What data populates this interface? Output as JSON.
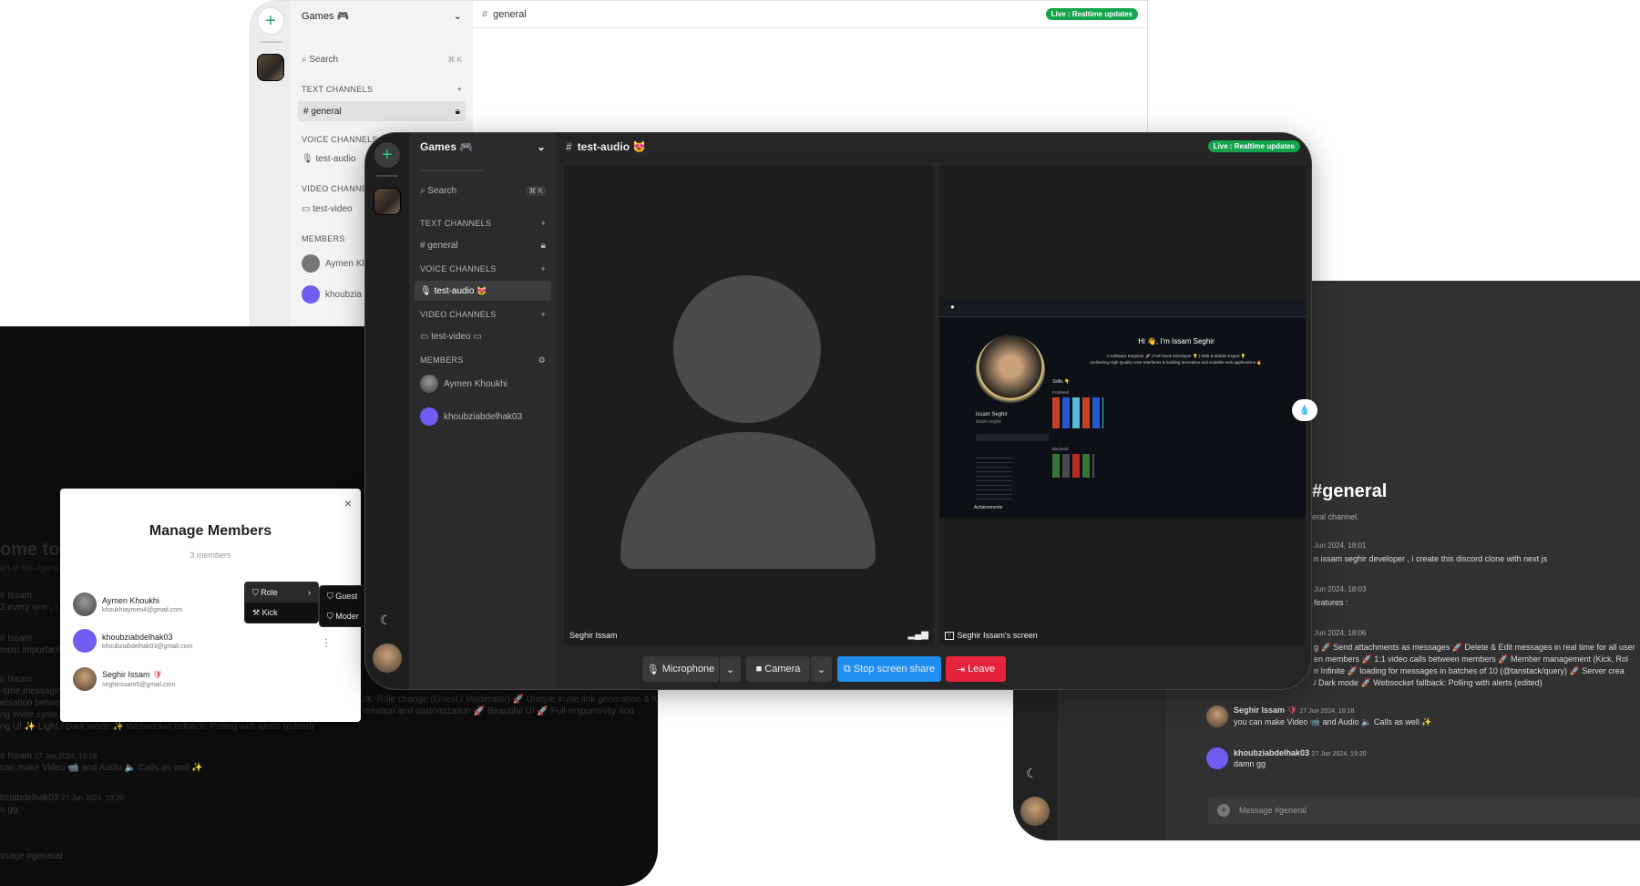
{
  "server": {
    "name": "Games",
    "emoji": "🎮"
  },
  "search": {
    "label": "Search",
    "shortcut": "⌘ K"
  },
  "sections": {
    "text": "TEXT CHANNELS",
    "voice": "VOICE CHANNELS",
    "video": "VIDEO CHANNELS",
    "members": "MEMBERS"
  },
  "channels": {
    "general": "general",
    "audio": "test-audio",
    "video": "test-video"
  },
  "live_badge": "Live : Realtime updates",
  "light_window": {
    "topbar_channel": "general",
    "voice_truncated": "VOICE CHANNELS",
    "video_truncated": "VIDEO CHANNE",
    "video_item": "test-video",
    "member1": "Aymen Kl",
    "member2": "khoubzia"
  },
  "main_window": {
    "topbar_channel": "test-audio",
    "members": [
      "Aymen Khoukhi",
      "khoubziabdelhak03"
    ],
    "tile_left_label": "Seghir Issam",
    "tile_right_label": "Seghir Issam's screen",
    "controls": {
      "mic": "Microphone",
      "camera": "Camera",
      "share": "Stop screen share",
      "leave": "Leave"
    },
    "shared_screen": {
      "greeting": "Hi 👋, I'm Issam Seghir",
      "tagline": "A Software Engineer 🚀 | Full Stack Developer 💡 | Web & Mobile Expert 💡",
      "tagline2": "Delivering High Quality User Interfaces & building innovative and scalable web applications 🔥",
      "skills": "Skills 👇",
      "frontend": "Frontend",
      "backend": "Backend",
      "profile_name": "issam Seghir",
      "profile_user": "issam seghir",
      "achievements": "Achievements"
    }
  },
  "modal": {
    "title": "Manage Members",
    "count": "3 members",
    "close": "×",
    "members": [
      {
        "name": "Aymen Khoukhi",
        "email": "khoukhiaymen4@gmail.com"
      },
      {
        "name": "khoubziabdelhak03",
        "email": "khoubziabdelhak03@gmail.com"
      },
      {
        "name": "Seghir Issam",
        "email": "seghirissam5@gmail.com"
      }
    ],
    "menu": {
      "role": "Role",
      "kick": "Kick",
      "guest": "Guest",
      "moderator": "Moder"
    }
  },
  "left_bg": {
    "welcome": "ome to",
    "sub": "art of this #gene",
    "names": [
      "ir Issam",
      "ir Issam",
      "ir Issam",
      "ir Issam",
      "bziabdelhak03"
    ],
    "lines": [
      "2 every one , i",
      "most important",
      "-time messaging",
      "ersation betwee",
      "ng invite syste",
      "ng UI  ✨ Light / Dark mode ✨ Websocket fallback: Polling with alerts (edited)",
      "can make Video 📹 and Audio 🔈 Calls as well ✨",
      "n gg"
    ],
    "mid": [
      "ck, Role change (Guest / Moderator) 🚀 Unique invite link generation & full",
      "creation and customization 🚀 Beautiful UI 🚀 Full responsivity and"
    ],
    "ts1": "27 Jun 2024, 18:18",
    "ts2": "27 Jun 2024, 19:20",
    "input": "ssage #general"
  },
  "right_window": {
    "title": "#general",
    "subtitle": "eral channel.",
    "messages": [
      {
        "ts": "Jun 2024, 18:01",
        "text": "n issam seghir developer , i create this discord clone with next js"
      },
      {
        "ts": "Jun 2024, 18:03",
        "text": "features :"
      },
      {
        "ts": "Jun 2024, 18:06",
        "text": "g 🚀 Send attachments as messages 🚀 Delete & Edit messages in real time for all user"
      },
      {
        "ts": "",
        "text": "en members 🚀 1:1 video calls between members 🚀 Member management (Kick, Rol"
      },
      {
        "ts": "",
        "text": "n Infinite 🚀 loading for messages in batches of 10 (@tanstack/query) 🚀 Server crea"
      },
      {
        "ts": "",
        "text": "/ Dark mode 🚀 Websocket fallback: Polling with alerts (edited)"
      }
    ],
    "m1_name": "Seghir Issam",
    "m1_ts": "27 Jun 2024, 18:18",
    "m1_text": "you can make Video 📹 and Audio 🔈 Calls as well ✨",
    "m2_name": "khoubziabdelhak03",
    "m2_ts": "27 Jun 2024, 19:20",
    "m2_text": "damn gg",
    "input_placeholder": "Message #general"
  }
}
